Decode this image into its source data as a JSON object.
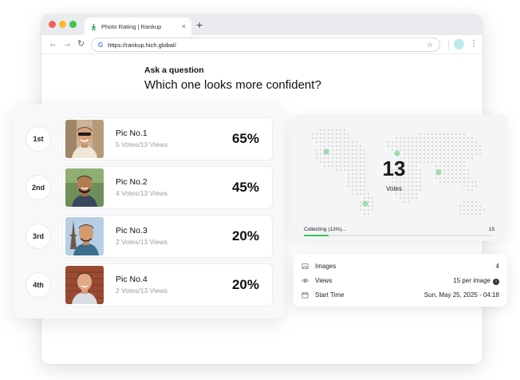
{
  "browser": {
    "tab_title": "Photo Rating | Rankup",
    "tab_close": "×",
    "new_tab": "+",
    "url": "https://rankup.hich.global/"
  },
  "question": {
    "label": "Ask a question",
    "text": "Which one looks more confident?"
  },
  "ranking": [
    {
      "rank": "1st",
      "name": "Pic No.1",
      "stats": "5 Votes/13 Views",
      "percent": "65%"
    },
    {
      "rank": "2nd",
      "name": "Pic No.2",
      "stats": "4 Votes/13 Views",
      "percent": "45%"
    },
    {
      "rank": "3rd",
      "name": "Pic No.3",
      "stats": "2 Votes/13 Views",
      "percent": "20%"
    },
    {
      "rank": "4th",
      "name": "Pic No.4",
      "stats": "2 Votes/13 Views",
      "percent": "20%"
    }
  ],
  "votes": {
    "count": "13",
    "label": "Votes",
    "collecting": "Collecting (13%)...",
    "target": "15",
    "progress_fraction": 0.13
  },
  "info": {
    "images_label": "Images",
    "images_value": "4",
    "views_label": "Views",
    "views_value": "15 per image",
    "start_label": "Start Time",
    "start_value": "Sun, May 25, 2025 - 04:18"
  },
  "colors": {
    "accent_green": "#3fbf5d",
    "map_dot": "#d2d5da"
  },
  "icons": {
    "tab_favicon": "download-arrow-icon",
    "images": "image-icon",
    "views": "eye-icon",
    "start_time": "calendar-icon",
    "views_info": "info-icon"
  }
}
